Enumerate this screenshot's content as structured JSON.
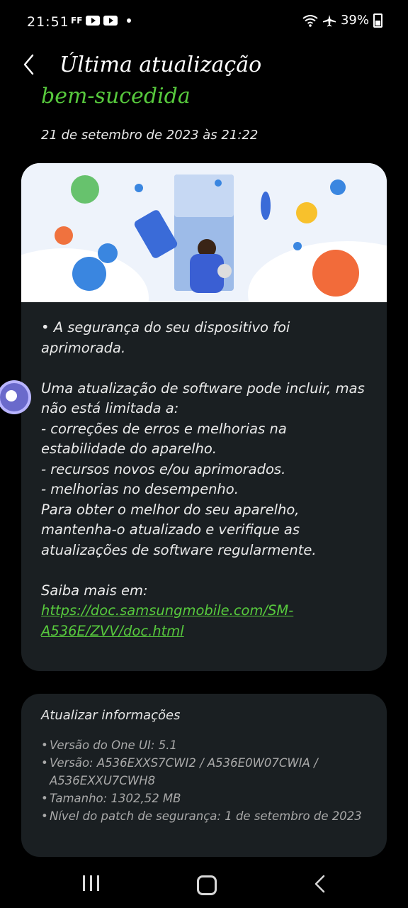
{
  "status_bar": {
    "time": "21:51",
    "left_icons": [
      "ff-icon",
      "youtube-icon",
      "youtube-icon",
      "notification-dot"
    ],
    "right_icons": [
      "wifi-icon",
      "airplane-icon"
    ],
    "battery": "39%"
  },
  "header": {
    "title": "Última atualização",
    "headline": "bem-sucedida",
    "date": "21 de setembro de 2023 às 21:22"
  },
  "release_notes": {
    "paragraph1": "• A segurança do seu dispositivo foi aprimorada.",
    "paragraph2": "Uma atualização de software pode incluir, mas não está limitada a:\n - correções de erros e melhorias na estabilidade do aparelho.\n - recursos novos e/ou aprimorados.\n - melhorias no desempenho.\nPara obter o melhor do seu aparelho, mantenha-o atualizado e verifique as atualizações de software regularmente.",
    "learn_more_label": "Saiba mais em:",
    "link": "https://doc.samsungmobile.com/SM-A536E/ZVV/doc.html"
  },
  "update_info": {
    "title": "Atualizar informações",
    "items": [
      "Versão do One UI: 5.1",
      "Versão: A536EXXS7CWI2 / A536E0W07CWIA / A536EXXU7CWH8",
      "Tamanho: 1302,52 MB",
      "Nível do patch de segurança: 1 de setembro de 2023"
    ]
  },
  "colors": {
    "accent_green": "#57c93d",
    "card_bg": "#1a1f22",
    "background": "#000000"
  }
}
